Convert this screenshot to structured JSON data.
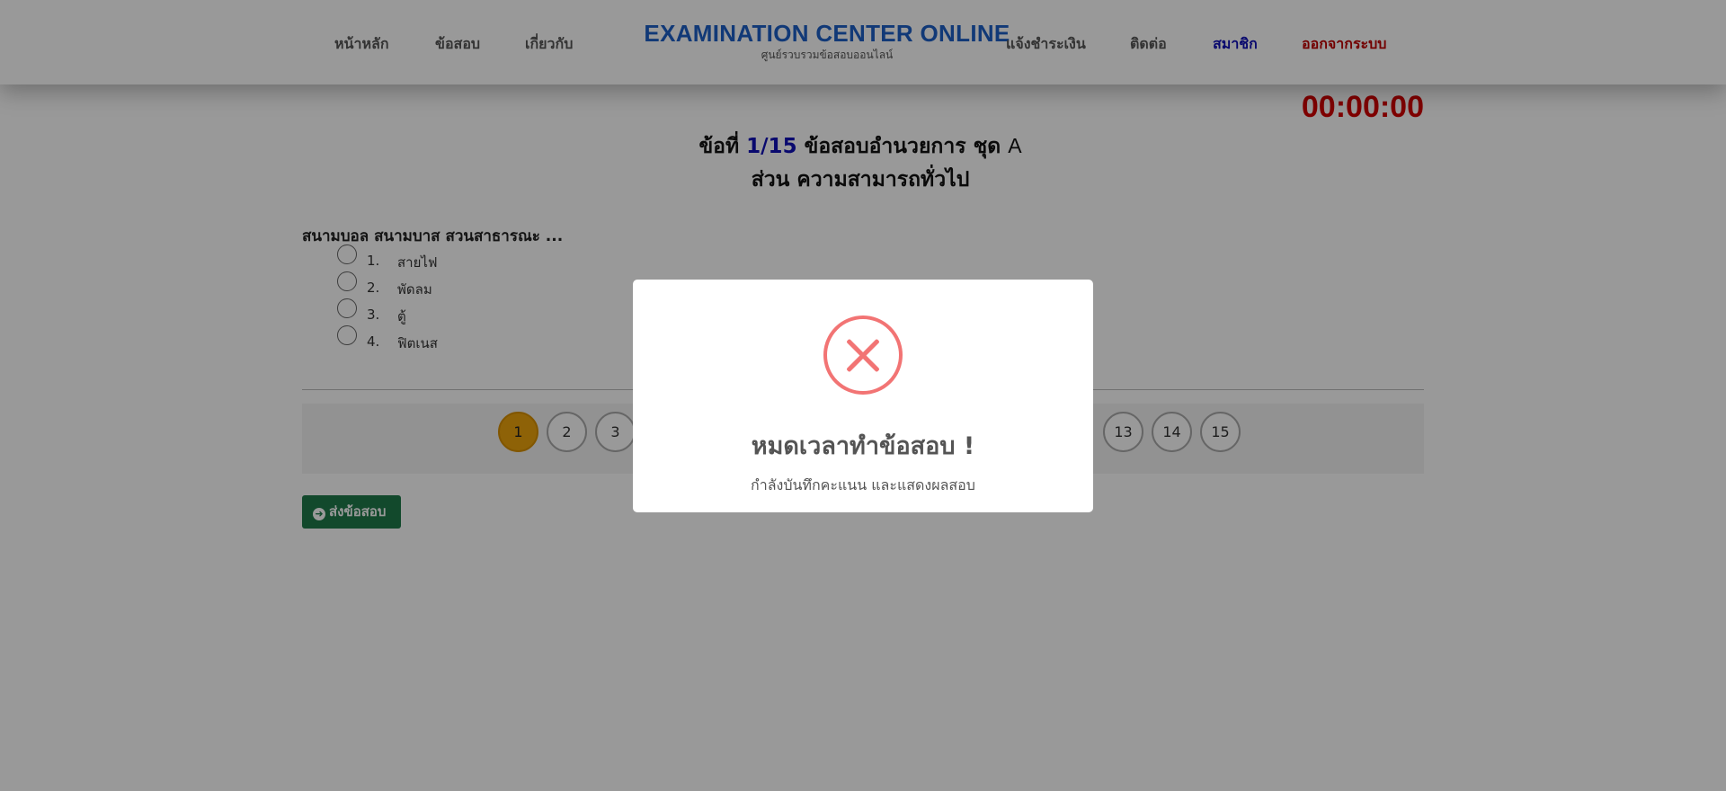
{
  "nav": {
    "home": "หน้าหลัก",
    "exams": "ข้อสอบ",
    "about": "เกี่ยวกับ",
    "payment": "แจ้งชำระเงิน",
    "contact": "ติดต่อ",
    "member": "สมาชิก",
    "logout": "ออกจากระบบ"
  },
  "brand": {
    "title": "EXAMINATION CENTER ONLINE",
    "subtitle": "ศูนย์รวบรวมข้อสอบออนไลน์"
  },
  "timer": "00:00:00",
  "question_header": {
    "prefix": "ข้อที่",
    "number": "1/15",
    "name": "ข้อสอบอำนวยการ ชุด",
    "set": "A",
    "section": "ส่วน ความสามารถทั่วไป"
  },
  "question": {
    "text": "สนามบอล สนามบาส สวนสาธารณะ ...",
    "choices": [
      {
        "num": "1.",
        "text": "สายไฟ"
      },
      {
        "num": "2.",
        "text": "พัดลม"
      },
      {
        "num": "3.",
        "text": "ตู้"
      },
      {
        "num": "4.",
        "text": "ฟิตเนส"
      }
    ]
  },
  "pagination": {
    "visible_left": [
      "1",
      "2",
      "3"
    ],
    "visible_right": [
      "13",
      "14",
      "15"
    ],
    "active": "1"
  },
  "submit_label": "ส่งข้อสอบ",
  "modal": {
    "title": "หมดเวลาทำข้อสอบ !",
    "text": "กำลังบันทึกคะแนน และแสดงผลสอบ",
    "icon": "error-x-icon"
  },
  "colors": {
    "brand": "#1d5fc7",
    "timer": "#d40000",
    "member": "#1010b8",
    "logout": "#c00000",
    "active_page": "#eda40c",
    "submit": "#1e7a4a",
    "error": "#f27474"
  }
}
